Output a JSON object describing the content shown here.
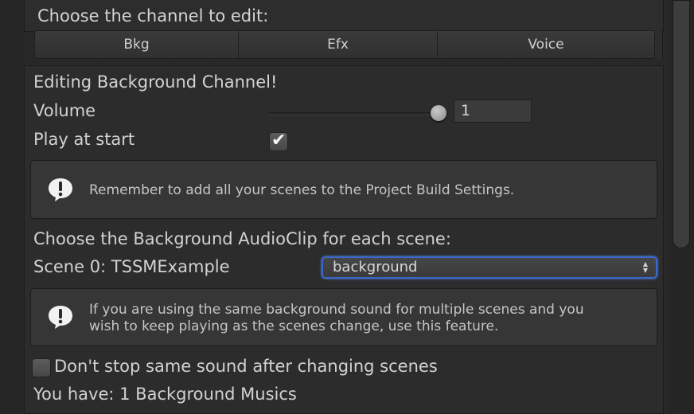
{
  "header": {
    "title": "Choose the channel to edit:"
  },
  "tabs": [
    {
      "label": "Bkg"
    },
    {
      "label": "Efx"
    },
    {
      "label": "Voice"
    }
  ],
  "editor": {
    "heading": "Editing Background Channel!",
    "volume_label": "Volume",
    "volume_value": "1",
    "volume_slider_fraction": 1.0,
    "play_at_start_label": "Play at start",
    "play_at_start_checked": true,
    "help1": "Remember to add all your scenes to the Project Build Settings.",
    "choose_clip_label": "Choose the Background AudioClip for each scene:",
    "scene_label": "Scene 0: TSSMExample",
    "scene_clip_value": "background",
    "help2_line1": "If you are using the same background sound for multiple scenes and you",
    "help2_line2": "wish to keep playing as the scenes change, use this feature.",
    "dont_stop_label": "Don't stop same sound after changing scenes",
    "dont_stop_checked": false,
    "count_text": "You have: 1 Background Musics"
  },
  "colors": {
    "background": "#282828",
    "panel": "#2c2c2c",
    "helpbox": "#363636",
    "focus_accent": "#3a68cc"
  },
  "icons": {
    "info": "info-speech-bubble-icon",
    "check": "checkmark-icon",
    "dropdown": "updown-arrows-icon"
  }
}
